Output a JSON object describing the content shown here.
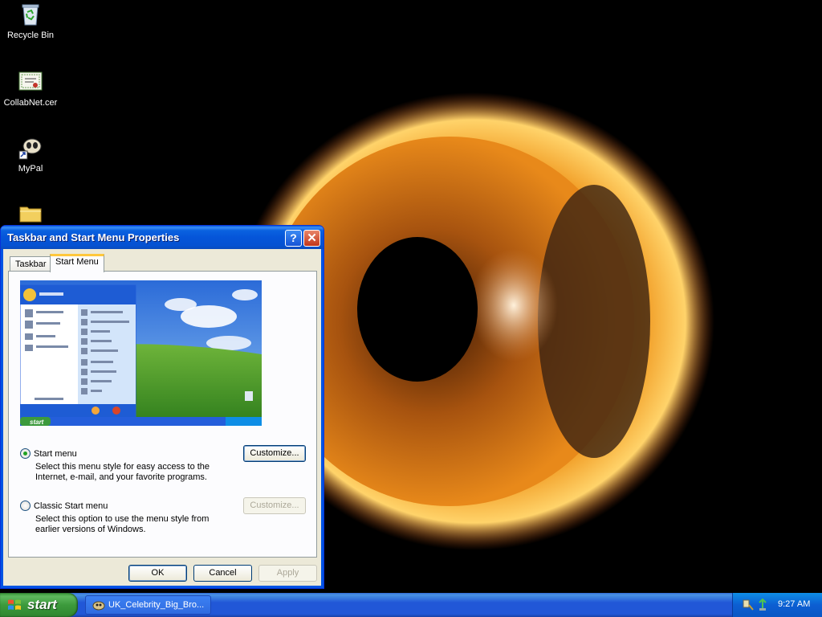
{
  "desktop": {
    "icons": [
      {
        "label": "Recycle Bin",
        "icon": "recycle-bin-icon"
      },
      {
        "label": "CollabNet.cer",
        "icon": "certificate-icon"
      },
      {
        "label": "MyPal",
        "icon": "mypal-shortcut-icon"
      },
      {
        "label": "",
        "icon": "folder-icon"
      }
    ]
  },
  "dialog": {
    "title": "Taskbar and Start Menu Properties",
    "help_glyph": "?",
    "close_glyph": "✕",
    "tabs": [
      {
        "label": "Taskbar",
        "selected": false
      },
      {
        "label": "Start Menu",
        "selected": true
      }
    ],
    "preview_start_label": "start",
    "options": [
      {
        "label": "Start menu",
        "checked": true,
        "description": "Select this menu style for easy access to the Internet, e-mail, and your favorite programs.",
        "button": "Customize...",
        "button_enabled": true
      },
      {
        "label": "Classic Start menu",
        "checked": false,
        "description": "Select this option to use the menu style from earlier versions of Windows.",
        "button": "Customize...",
        "button_enabled": false
      }
    ],
    "buttons": {
      "ok": "OK",
      "cancel": "Cancel",
      "apply": "Apply"
    }
  },
  "taskbar": {
    "start_label": "start",
    "task_item": "UK_Celebrity_Big_Bro...",
    "clock": "9:27 AM"
  },
  "colors": {
    "title_bar": "#0555d9",
    "dialog_bg": "#ece9d8",
    "taskbar": "#2157d7",
    "start_button": "#3c9a3c",
    "fire": "#f08a18",
    "pupil": "#000000"
  }
}
